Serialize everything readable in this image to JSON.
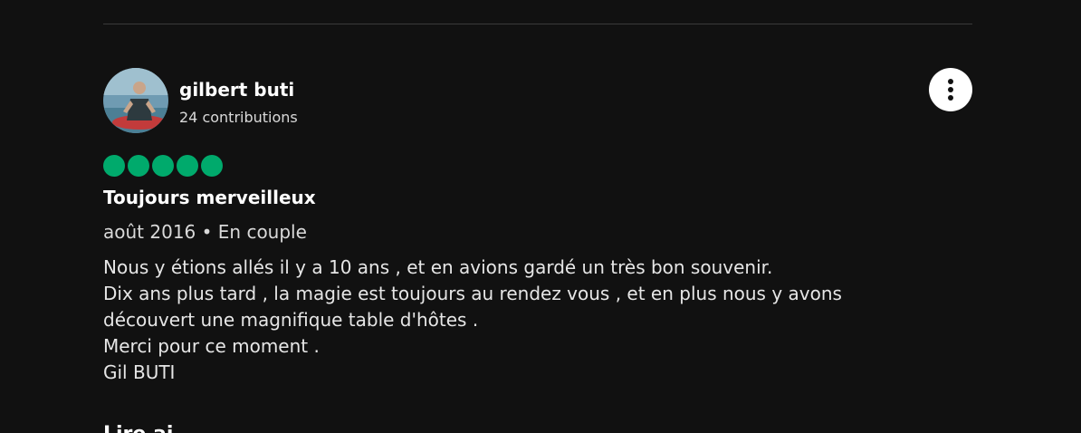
{
  "review": {
    "user": {
      "name": "gilbert buti",
      "contributions": "24 contributions"
    },
    "rating": 5,
    "rating_color": "#00aa6c",
    "title": "Toujours merveilleux",
    "visit_line": "août 2016 • En couple",
    "body_lines": [
      "Nous y étions allés il y a 10 ans , et en avions gardé un très bon souvenir.",
      "Dix ans plus tard , la magie est toujours au rendez vous , et en plus nous y avons",
      "découvert une magnifique table d'hôtes .",
      "Merci pour ce moment .",
      "Gil BUTI"
    ]
  },
  "icons": {
    "more": "more-options-icon"
  },
  "next_section": {
    "heading_partial": "Lire ai"
  },
  "colors": {
    "background": "#111111",
    "divider": "#3a3a3a"
  }
}
